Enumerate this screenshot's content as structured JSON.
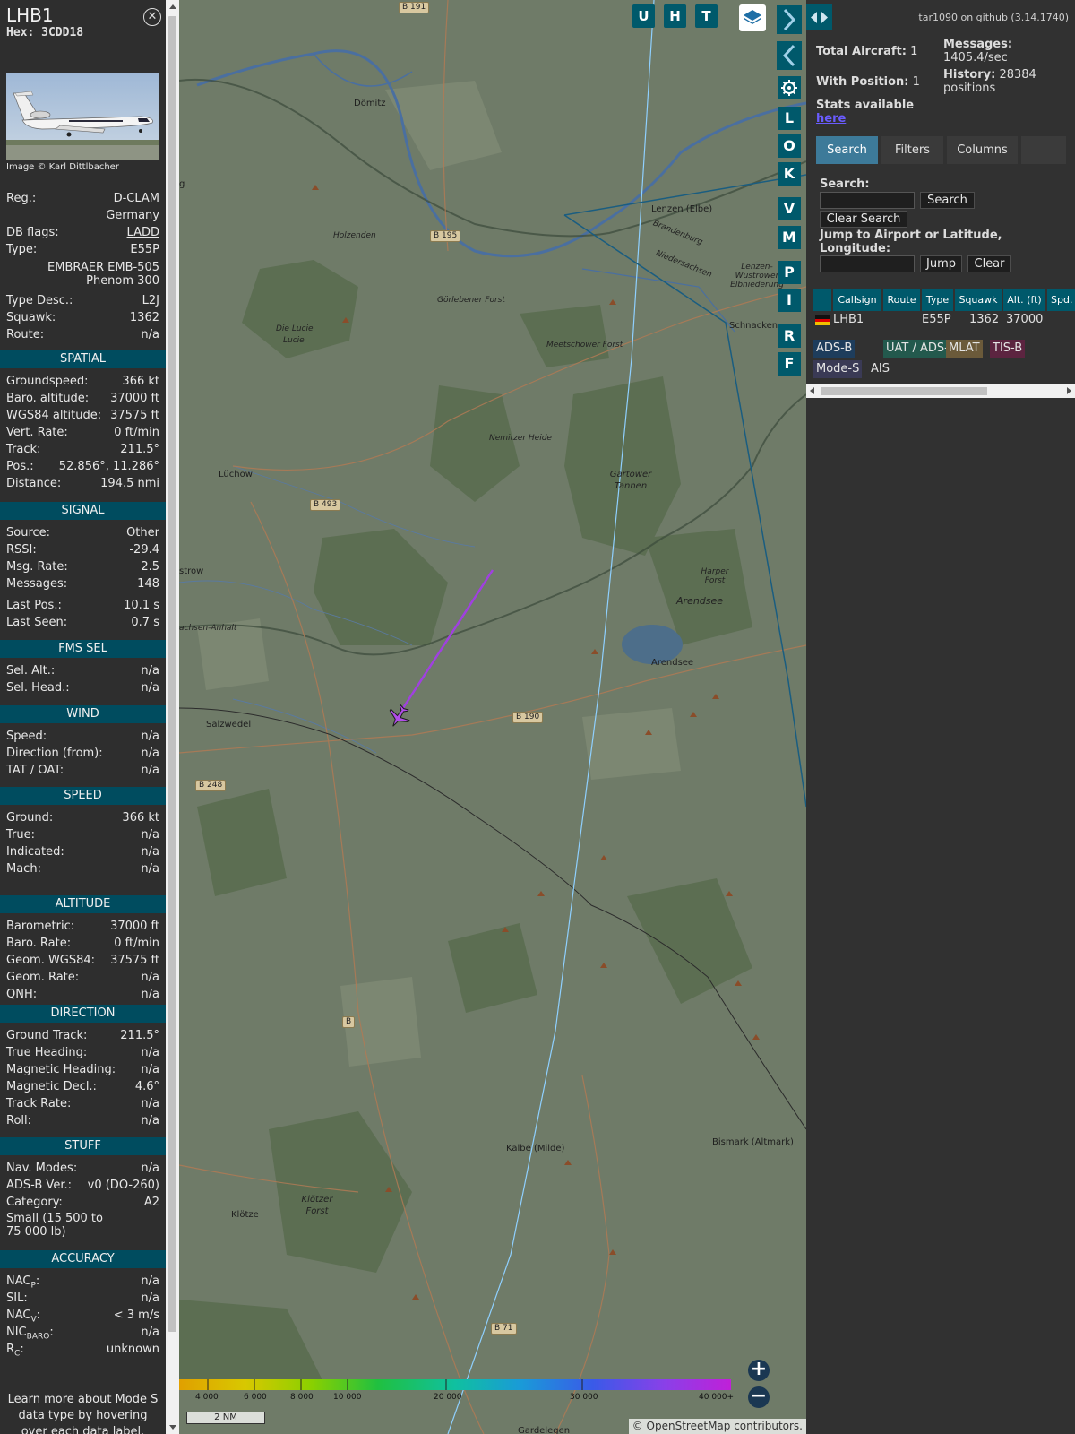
{
  "aircraft": {
    "callsign": "LHB1",
    "hex": "Hex: 3CDD18",
    "photo_credit": "Image © Karl Dittlbacher"
  },
  "details": [
    {
      "k": "Reg.:",
      "v": "D-CLAM",
      "link": true
    },
    {
      "k": "",
      "v": "Germany"
    },
    {
      "k": "DB flags:",
      "v": "LADD",
      "link": true
    },
    {
      "k": "Type:",
      "v": "E55P"
    },
    {
      "k": "",
      "v": "EMBRAER EMB-505 Phenom 300"
    },
    {
      "k": "Type Desc.:",
      "v": "L2J"
    },
    {
      "k": "Squawk:",
      "v": "1362"
    },
    {
      "k": "Route:",
      "v": "n/a"
    }
  ],
  "sections": {
    "spatial": {
      "title": "SPATIAL",
      "rows": [
        {
          "k": "Groundspeed:",
          "v": "366 kt"
        },
        {
          "k": "Baro. altitude:",
          "v": "37000 ft"
        },
        {
          "k": "WGS84 altitude:",
          "v": "37575 ft"
        },
        {
          "k": "Vert. Rate:",
          "v": "0 ft/min"
        },
        {
          "k": "Track:",
          "v": "211.5°"
        },
        {
          "k": "Pos.:",
          "v": "52.856°, 11.286°"
        },
        {
          "k": "Distance:",
          "v": "194.5 nmi"
        }
      ]
    },
    "signal": {
      "title": "SIGNAL",
      "rows": [
        {
          "k": "Source:",
          "v": "Other"
        },
        {
          "k": "RSSI:",
          "v": "-29.4"
        },
        {
          "k": "Msg. Rate:",
          "v": "2.5"
        },
        {
          "k": "Messages:",
          "v": "148"
        },
        {
          "k": "Last Pos.:",
          "v": "10.1 s"
        },
        {
          "k": "Last Seen:",
          "v": "0.7 s"
        }
      ]
    },
    "fms": {
      "title": "FMS SEL",
      "rows": [
        {
          "k": "Sel. Alt.:",
          "v": "n/a"
        },
        {
          "k": "Sel. Head.:",
          "v": "n/a"
        }
      ]
    },
    "wind": {
      "title": "WIND",
      "rows": [
        {
          "k": "Speed:",
          "v": "n/a"
        },
        {
          "k": "Direction (from):",
          "v": "n/a"
        },
        {
          "k": "TAT / OAT:",
          "v": "n/a"
        }
      ]
    },
    "speed": {
      "title": "SPEED",
      "rows": [
        {
          "k": "Ground:",
          "v": "366 kt"
        },
        {
          "k": "True:",
          "v": "n/a"
        },
        {
          "k": "Indicated:",
          "v": "n/a"
        },
        {
          "k": "Mach:",
          "v": "n/a"
        }
      ]
    },
    "altitude": {
      "title": "ALTITUDE",
      "rows": [
        {
          "k": "Barometric:",
          "v": "37000 ft"
        },
        {
          "k": "Baro. Rate:",
          "v": "0 ft/min"
        },
        {
          "k": "Geom. WGS84:",
          "v": "37575 ft"
        },
        {
          "k": "Geom. Rate:",
          "v": "n/a"
        },
        {
          "k": "QNH:",
          "v": "n/a"
        }
      ]
    },
    "direction": {
      "title": "DIRECTION",
      "rows": [
        {
          "k": "Ground Track:",
          "v": "211.5°"
        },
        {
          "k": "True Heading:",
          "v": "n/a"
        },
        {
          "k": "Magnetic Heading:",
          "v": "n/a"
        },
        {
          "k": "Magnetic Decl.:",
          "v": "4.6°"
        },
        {
          "k": "Track Rate:",
          "v": "n/a"
        },
        {
          "k": "Roll:",
          "v": "n/a"
        }
      ]
    },
    "stuff": {
      "title": "STUFF",
      "rows": [
        {
          "k": "Nav. Modes:",
          "v": "n/a"
        },
        {
          "k": "ADS-B Ver.:",
          "v": "v0 (DO-260)"
        },
        {
          "k": "Category:",
          "v": "A2"
        }
      ],
      "category_desc": "Small (15 500 to 75 000 lb)"
    },
    "accuracy": {
      "title": "ACCURACY",
      "rows": [
        {
          "k": "NAC",
          "sub": "P",
          "v": "n/a"
        },
        {
          "k": "SIL:",
          "v": "n/a"
        },
        {
          "k": "NAC",
          "sub": "V",
          "v": "< 3 m/s"
        },
        {
          "k": "NIC",
          "sub": "BARO",
          "v": "n/a"
        },
        {
          "k": "R",
          "sub": "C",
          "v": "unknown"
        }
      ]
    },
    "footer": "Learn more about Mode S data type by hovering over each data label."
  },
  "map": {
    "places": [
      "Dömitz",
      "Lenzen (Elbe)",
      "Holzenden",
      "Görlebener Forst",
      "Die Lucie",
      "Lucie",
      "Meetschower Forst",
      "Lenzen-Wustrower Elbniederung",
      "Schnacken",
      "Brandenburg",
      "Niedersachsen",
      "Nemitzer Heide",
      "Lüchow",
      "Gartower Tannen",
      "strow",
      "Harper Forst",
      "Arendsee",
      "Arendsee",
      "achsen-Anhalt",
      "Salzwedel",
      "Kalbe (Milde)",
      "Bismark (Altmark)",
      "Klötze",
      "Klötzer Forst",
      "Gardelegen",
      "g"
    ],
    "roads": [
      "B 191",
      "B 195",
      "B 493",
      "B 190",
      "B 248",
      "B",
      "B 71"
    ],
    "toolbar_top": [
      "U",
      "H",
      "T"
    ],
    "toolbar_side": [
      "L",
      "O",
      "K",
      "V",
      "M",
      "P",
      "I",
      "R",
      "F"
    ],
    "altitude_scale": [
      "4 000",
      "6 000",
      "8 000",
      "10 000",
      "20 000",
      "30 000",
      "40 000+"
    ],
    "scale_bar": "2 NM",
    "attribution": "© OpenStreetMap contributors.",
    "zoom_in": "+",
    "zoom_out": "−"
  },
  "right": {
    "github": "tar1090 on github (3.14.1740)",
    "total_label": "Total Aircraft:",
    "total_value": "1",
    "withpos_label": "With Position:",
    "withpos_value": "1",
    "stats_label": "Stats available",
    "stats_link": "here",
    "messages_label": "Messages:",
    "messages_value": "1405.4/sec",
    "history_label": "History:",
    "history_value": "28384 positions",
    "tabs": [
      "Search",
      "Filters",
      "Columns"
    ],
    "search_label": "Search:",
    "search_btn": "Search",
    "clear_search_btn": "Clear Search",
    "jump_label": "Jump to Airport or Latitude, Longitude:",
    "jump_btn": "Jump",
    "clear_btn": "Clear",
    "columns": [
      "Callsign",
      "Route",
      "Type",
      "Squawk",
      "Alt. (ft)",
      "Spd."
    ],
    "row": {
      "callsign": "LHB1",
      "route": "",
      "type": "E55P",
      "squawk": "1362",
      "alt": "37000"
    },
    "legend": [
      {
        "label": "ADS-B",
        "bg": "#1e3d5c"
      },
      {
        "label": "UAT / ADS-R",
        "bg": "#23594d"
      },
      {
        "label": "MLAT",
        "bg": "#6b5a3a"
      },
      {
        "label": "TIS-B",
        "bg": "#5c2440"
      },
      {
        "label": "Mode-S",
        "bg": "#3a3a55"
      },
      {
        "label": "AIS",
        "bg": "#313131"
      }
    ]
  },
  "colors": {
    "panel": "#2e2e2e",
    "section": "#004c5f",
    "button": "#00596b",
    "track": "#a040e0"
  }
}
